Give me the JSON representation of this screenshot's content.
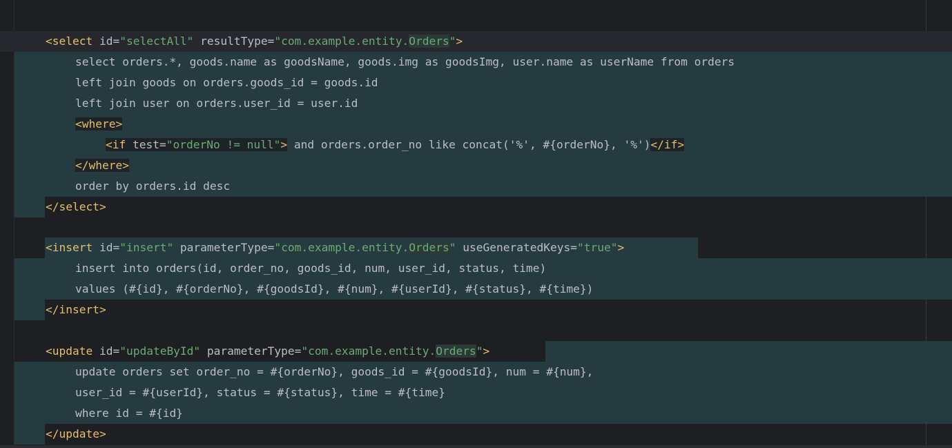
{
  "editor": {
    "language": "MyBatis XML mapper",
    "colors": {
      "background": "#1e1f22",
      "selection": "#273a3f",
      "tag": "#e8bf6a",
      "string": "#6aab73",
      "text": "#bcbec4"
    },
    "select_block": {
      "open_tag": "<select",
      "id_attr": " id=",
      "id_value": "\"selectAll\"",
      "type_attr": " resultType=",
      "type_value_prefix": "\"com.example.entity.",
      "type_value_entity": "Orders",
      "type_value_suffix": "\"",
      "open_close": ">",
      "line1": "select orders.*, goods.name as goodsName, goods.img as goodsImg, user.name as userName from orders",
      "line2": "left join goods on orders.goods_id = goods.id",
      "line3": "left join user on orders.user_id = user.id",
      "where_open": "<where>",
      "if_open": "<if",
      "if_test_attr": " test=",
      "if_test_value": "\"orderNo != null\"",
      "if_gt": ">",
      "if_body": " and orders.order_no like concat('%', #{orderNo}, '%')",
      "if_close": "</if>",
      "where_close": "</where>",
      "order_line": "order by orders.id desc",
      "close_tag": "</select>"
    },
    "insert_block": {
      "open_tag": "<insert",
      "id_attr": " id=",
      "id_value": "\"insert\"",
      "type_attr": " parameterType=",
      "type_value_prefix": "\"com.example.entity.",
      "type_value_entity": "Orders",
      "type_value_suffix": "\"",
      "keys_attr": " useGeneratedKeys=",
      "keys_value": "\"true\"",
      "open_close": ">",
      "line1": "insert into orders(id, order_no, goods_id, num, user_id, status, time)",
      "line2": "values (#{id}, #{orderNo}, #{goodsId}, #{num}, #{userId}, #{status}, #{time})",
      "close_tag": "</insert>"
    },
    "update_block": {
      "open_tag": "<update",
      "id_attr": " id=",
      "id_value": "\"updateById\"",
      "type_attr": " parameterType=",
      "type_value_prefix": "\"com.example.entity.",
      "type_value_entity": "Orders",
      "type_value_suffix": "\"",
      "open_close": ">",
      "line1": "update orders set order_no = #{orderNo}, goods_id = #{goodsId}, num = #{num},",
      "line2": "user_id = #{userId}, status = #{status}, time = #{time}",
      "line3": "where id = #{id}",
      "close_tag": "</update>"
    }
  }
}
